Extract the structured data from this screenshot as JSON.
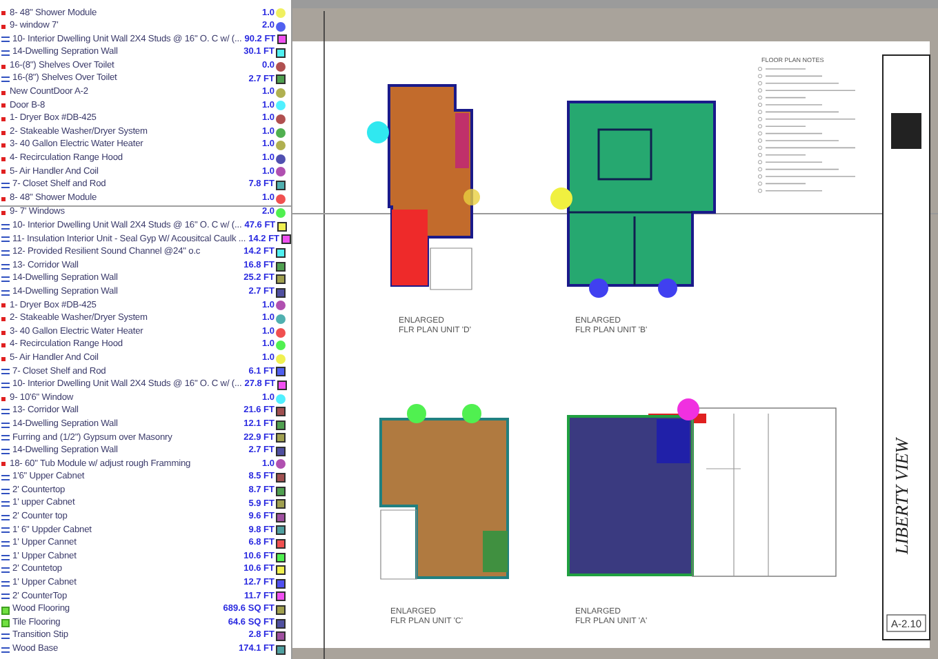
{
  "items": [
    {
      "name": "8- 48\" Shower Module",
      "value": "1.0",
      "kind": "count",
      "color": "#f0f060"
    },
    {
      "name": "9- window 7'",
      "value": "2.0",
      "kind": "count",
      "color": "#5060f0"
    },
    {
      "name": "10- Interior Dwelling Unit Wall 2X4 Studs @ 16\" O. C w/ (...",
      "value": "90.2 FT",
      "kind": "linear",
      "color": "#f050f0"
    },
    {
      "name": "14-Dwelling Sepration Wall",
      "value": "30.1 FT",
      "kind": "linear",
      "color": "#50f0f0"
    },
    {
      "name": "16-(8\") Shelves Over Toilet",
      "value": "0.0",
      "kind": "count",
      "color": "#b05050"
    },
    {
      "name": "16-(8\") Shelves Over Toilet",
      "value": "2.7 FT",
      "kind": "linear",
      "color": "#50a050"
    },
    {
      "name": "New CountDoor A-2",
      "value": "1.0",
      "kind": "count",
      "color": "#b0b050"
    },
    {
      "name": "Door B-8",
      "value": "1.0",
      "kind": "count",
      "color": "#50f0ff"
    },
    {
      "name": "1- Dryer Box #DB-425",
      "value": "1.0",
      "kind": "count",
      "color": "#b05050"
    },
    {
      "name": "2- Stakeable Washer/Dryer System",
      "value": "1.0",
      "kind": "count",
      "color": "#50b050"
    },
    {
      "name": "3- 40 Gallon Electric Water Heater",
      "value": "1.0",
      "kind": "count",
      "color": "#b0b050"
    },
    {
      "name": "4- Recirculation Range Hood",
      "value": "1.0",
      "kind": "count",
      "color": "#5050b0"
    },
    {
      "name": "5- Air Handler And Coil",
      "value": "1.0",
      "kind": "count",
      "color": "#b050b0"
    },
    {
      "name": "7- Closet Shelf and Rod",
      "value": "7.8 FT",
      "kind": "linear",
      "color": "#50b0b0"
    },
    {
      "name": "8- 48\" Shower Module",
      "value": "1.0",
      "kind": "count",
      "color": "#f05050"
    },
    {
      "name": "9- 7' Windows",
      "value": "2.0",
      "kind": "count",
      "color": "#50f050"
    },
    {
      "name": "10- Interior Dwelling Unit Wall 2X4 Studs @ 16\" O. C w/ (...",
      "value": "47.6 FT",
      "kind": "linear",
      "color": "#f0f050"
    },
    {
      "name": "11- Insulation Interior Unit - Seal Gyp W/ Acousitcal Caulk ...",
      "value": "14.2 FT",
      "kind": "linear",
      "color": "#f050f0"
    },
    {
      "name": "12- Provided Resilient Sound Channel @24\" o.c",
      "value": "14.2 FT",
      "kind": "linear",
      "color": "#50f0f0"
    },
    {
      "name": "13- Corridor Wall",
      "value": "16.8 FT",
      "kind": "linear",
      "color": "#50a050"
    },
    {
      "name": "14-Dwelling Sepration Wall",
      "value": "25.2 FT",
      "kind": "linear",
      "color": "#a0a050"
    },
    {
      "name": "14-Dwelling Sepration Wall",
      "value": "2.7 FT",
      "kind": "linear",
      "color": "#5050a0"
    },
    {
      "name": "1- Dryer Box #DB-425",
      "value": "1.0",
      "kind": "count",
      "color": "#b050b0"
    },
    {
      "name": "2- Stakeable Washer/Dryer System",
      "value": "1.0",
      "kind": "count",
      "color": "#50b0b0"
    },
    {
      "name": "3- 40 Gallon Electric Water Heater",
      "value": "1.0",
      "kind": "count",
      "color": "#f05050"
    },
    {
      "name": "4- Recirculation Range Hood",
      "value": "1.0",
      "kind": "count",
      "color": "#50f050"
    },
    {
      "name": "5- Air Handler And Coil",
      "value": "1.0",
      "kind": "count",
      "color": "#f0f050"
    },
    {
      "name": "7- Closet Shelf and Rod",
      "value": "6.1 FT",
      "kind": "linear",
      "color": "#5060f0"
    },
    {
      "name": "10- Interior Dwelling Unit Wall 2X4 Studs @ 16\" O. C w/ (...",
      "value": "27.8 FT",
      "kind": "linear",
      "color": "#f050f0"
    },
    {
      "name": "9- 10'6\" Window",
      "value": "1.0",
      "kind": "count",
      "color": "#50f0ff"
    },
    {
      "name": "13- Corridor Wall",
      "value": "21.6 FT",
      "kind": "linear",
      "color": "#a05050"
    },
    {
      "name": "14-Dwelling Sepration Wall",
      "value": "12.1 FT",
      "kind": "linear",
      "color": "#50a050"
    },
    {
      "name": "Furring and (1/2\") Gypsum over Masonry",
      "value": "22.9 FT",
      "kind": "linear",
      "color": "#a0a050"
    },
    {
      "name": "14-Dwelling Sepration Wall",
      "value": "2.7 FT",
      "kind": "linear",
      "color": "#5050a0"
    },
    {
      "name": "18- 60\" Tub Module w/ adjust rough Framming",
      "value": "1.0",
      "kind": "count",
      "color": "#b050b0"
    },
    {
      "name": "1'6\"  Upper Cabnet",
      "value": "8.5 FT",
      "kind": "linear",
      "color": "#a05050"
    },
    {
      "name": "2' Countertop",
      "value": "8.7 FT",
      "kind": "linear",
      "color": "#50a050"
    },
    {
      "name": "1' upper Cabnet",
      "value": "5.9 FT",
      "kind": "linear",
      "color": "#a0a050"
    },
    {
      "name": "2' Counter top",
      "value": "9.6 FT",
      "kind": "linear",
      "color": "#a050a0"
    },
    {
      "name": "1' 6\" Uppder Cabnet",
      "value": "9.8 FT",
      "kind": "linear",
      "color": "#50a0a0"
    },
    {
      "name": "1' Upper Cannet",
      "value": "6.8 FT",
      "kind": "linear",
      "color": "#f05050"
    },
    {
      "name": "1' Upper Cabnet",
      "value": "10.6 FT",
      "kind": "linear",
      "color": "#50f050"
    },
    {
      "name": "2' Countetop",
      "value": "10.6 FT",
      "kind": "linear",
      "color": "#f0f050"
    },
    {
      "name": "1' Upper Cabnet",
      "value": "12.7 FT",
      "kind": "linear",
      "color": "#5050f0"
    },
    {
      "name": "2' CounterTop",
      "value": "11.7 FT",
      "kind": "linear",
      "color": "#f050f0"
    },
    {
      "name": "Wood Flooring",
      "value": "689.6 SQ FT",
      "kind": "area",
      "color": "#a0a050"
    },
    {
      "name": "Tile Flooring",
      "value": "64.6 SQ FT",
      "kind": "area",
      "color": "#5050a0"
    },
    {
      "name": "Transition Stip",
      "value": "2.8 FT",
      "kind": "linear",
      "color": "#a050a0"
    },
    {
      "name": "Wood Base",
      "value": "174.1 FT",
      "kind": "linear",
      "color": "#50a0a0"
    }
  ],
  "drawing": {
    "notes_title": "FLOOR PLAN NOTES",
    "plans": [
      {
        "heading": "ENLARGED",
        "title": "FLR PLAN UNIT 'D'"
      },
      {
        "heading": "ENLARGED",
        "title": "FLR PLAN UNIT 'B'"
      },
      {
        "heading": "ENLARGED",
        "title": "FLR PLAN UNIT 'C'"
      },
      {
        "heading": "ENLARGED",
        "title": "FLR PLAN UNIT 'A'"
      }
    ],
    "project_title": "LIBERTY VIEW",
    "sheet_number": "A-2.10"
  }
}
